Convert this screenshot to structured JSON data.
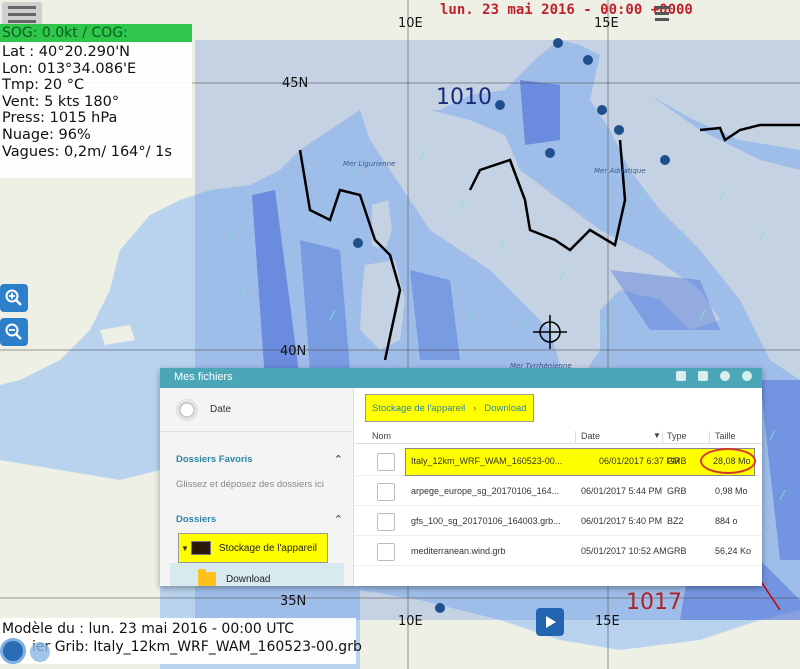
{
  "map": {
    "date": "lun. 23 mai 2016 - 00:00 +0000",
    "grid_labels": {
      "lat_45": "45N",
      "lat_40": "40N",
      "lat_35": "35N",
      "lon_10_top": "10E",
      "lon_15_top": "15E",
      "lon_10_bottom": "10E",
      "lon_15_bottom": "15E"
    },
    "pressure_labels": {
      "high_1010": "1010",
      "high_1017": "1017"
    },
    "sea_labels": {
      "ligurian": "Mer Ligurienne",
      "adriatic": "Mer Adriatique",
      "tyrrhenian": "Mer Tyrrhénienne"
    },
    "colors": {
      "land": "#eef0e6",
      "sea": "#b9d3ee",
      "overlay": "#5f86e0",
      "isobar": "#000000",
      "date_text": "#c0202a"
    }
  },
  "info_panel": {
    "sog_cog": "SOG: 0.0kt / COG:",
    "lat": "Lat :  40°20.290'N",
    "lon": "Lon: 013°34.086'E",
    "tmp": "Tmp:  20 °C",
    "vent": "Vent:   5 kts 180°",
    "press": "Press: 1015 hPa",
    "nuage": "Nuage: 96%",
    "vagues": "Vagues: 0,2m/ 164°/ 1s"
  },
  "zoom": {
    "in_icon": "zoom-in-icon",
    "out_icon": "zoom-out-icon"
  },
  "bottom": {
    "model": "Modèle du : lun. 23 mai 2016 - 00:00 UTC",
    "grib": "ier Grib: Italy_12km_WRF_WAM_160523-00.grb"
  },
  "file_manager": {
    "title": "Mes fichiers",
    "date_label": "Date",
    "favorites_title": "Dossiers Favoris",
    "favorites_hint": "Glissez et déposez des dossiers ici",
    "folders_title": "Dossiers",
    "storage_label": "Stockage de l'appareil",
    "download_label": "Download",
    "breadcrumb": {
      "root": "Stockage de l'appareil",
      "current": "Download"
    },
    "columns": {
      "name": "Nom",
      "date": "Date",
      "type": "Type",
      "size": "Taille"
    },
    "files": [
      {
        "name": "Italy_12km_WRF_WAM_160523-00...",
        "date": "06/01/2017 6:37 PM",
        "type": "GRB",
        "size": "28,08 Mo"
      },
      {
        "name": "arpege_europe_sg_20170106_164...",
        "date": "06/01/2017 5:44 PM",
        "type": "GRB",
        "size": "0,98 Mo"
      },
      {
        "name": "gfs_100_sg_20170106_164003.grb...",
        "date": "06/01/2017 5:40 PM",
        "type": "BZ2",
        "size": "884 o"
      },
      {
        "name": "mediterranean.wind.grb",
        "date": "05/01/2017 10:52 AM",
        "type": "GRB",
        "size": "56,24 Ko"
      }
    ]
  }
}
